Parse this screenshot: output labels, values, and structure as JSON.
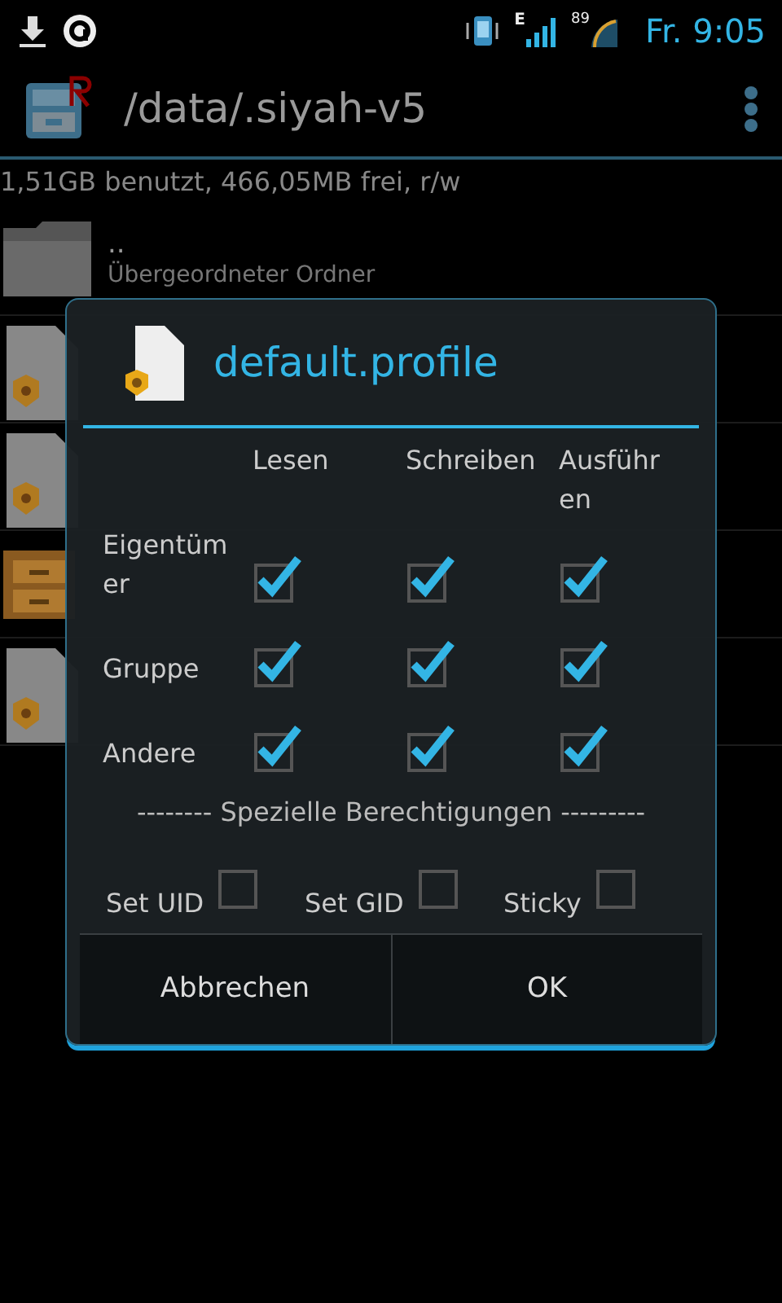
{
  "status_bar": {
    "time": "Fr. 9:05",
    "network": "E",
    "battery": "89"
  },
  "action_bar": {
    "title": "/data/.siyah-v5"
  },
  "storage_info": "1,51GB benutzt, 466,05MB frei, r/w",
  "files": [
    {
      "kind": "folder",
      "name": "..",
      "detail": "Übergeordneter Ordner"
    },
    {
      "kind": "profile"
    },
    {
      "kind": "profile"
    },
    {
      "kind": "archive"
    },
    {
      "kind": "profile"
    }
  ],
  "dialog": {
    "title": "default.profile",
    "columns": [
      "Lesen",
      "Schreiben",
      "Ausführen"
    ],
    "rows": [
      {
        "label": "Eigentümer",
        "checks": [
          true,
          true,
          true
        ]
      },
      {
        "label": "Gruppe",
        "checks": [
          true,
          true,
          true
        ]
      },
      {
        "label": "Andere",
        "checks": [
          true,
          true,
          true
        ]
      }
    ],
    "special_heading": "-------- Spezielle Berechtigungen ---------",
    "special": [
      {
        "label": "Set UID",
        "checked": false
      },
      {
        "label": "Set GID",
        "checked": false
      },
      {
        "label": "Sticky",
        "checked": false
      }
    ],
    "buttons": [
      "Abbrechen",
      "OK"
    ]
  }
}
